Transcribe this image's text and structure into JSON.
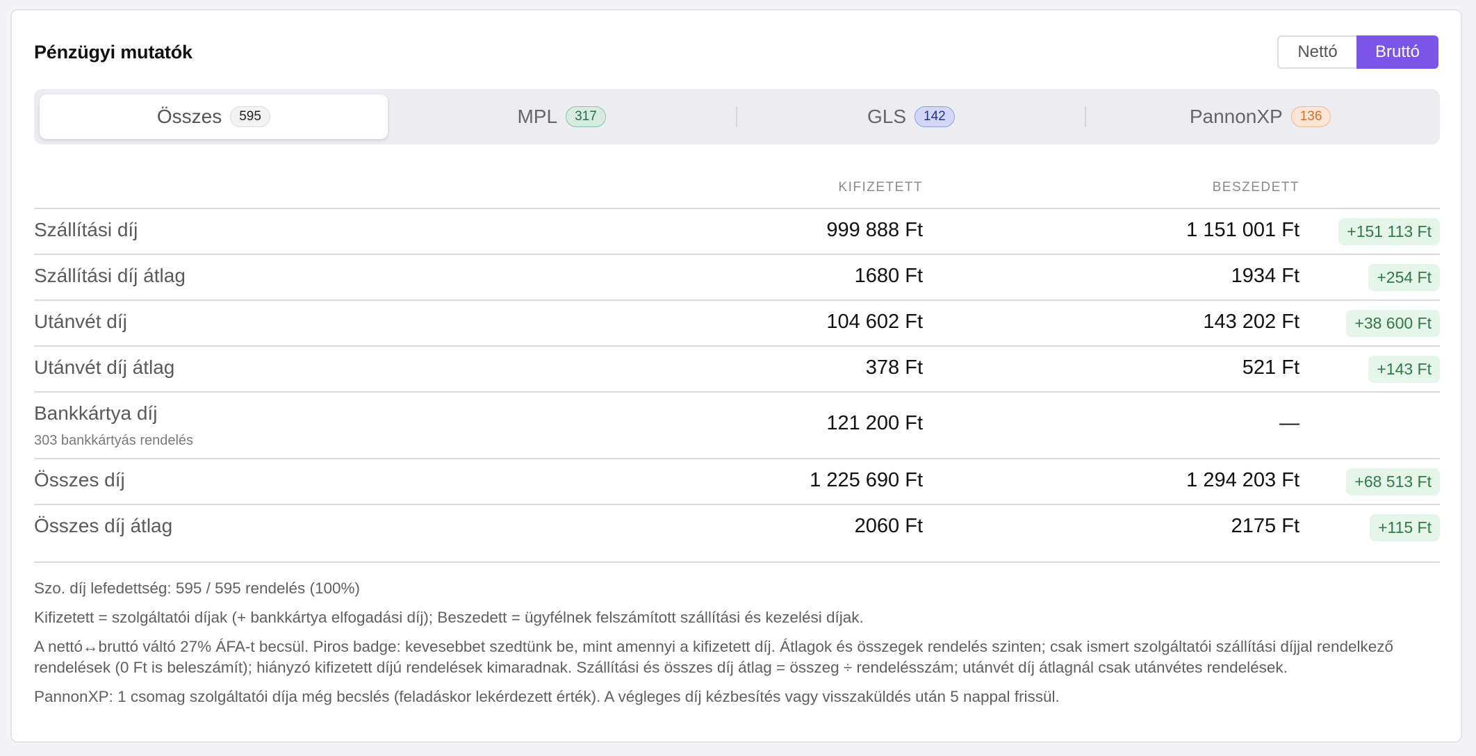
{
  "header": {
    "title": "Pénzügyi mutatók",
    "toggle": {
      "netto_label": "Nettó",
      "brutto_label": "Bruttó",
      "selected": "Bruttó"
    }
  },
  "colors": {
    "accent": "#7a55e8",
    "positive_badge_bg": "#e6f5ea",
    "positive_badge_text": "#2f7a44"
  },
  "tabs": [
    {
      "label": "Összes",
      "count": "595",
      "active": true
    },
    {
      "label": "MPL",
      "count": "317",
      "active": false
    },
    {
      "label": "GLS",
      "count": "142",
      "active": false
    },
    {
      "label": "PannonXP",
      "count": "136",
      "active": false
    }
  ],
  "table": {
    "columns": {
      "paid": "KIFIZETETT",
      "collected": "BESZEDETT"
    },
    "rows": [
      {
        "label": "Szállítási díj",
        "paid": "999 888 Ft",
        "collected": "1 151 001 Ft",
        "diff": "+151 113 Ft"
      },
      {
        "label": "Szállítási díj átlag",
        "paid": "1680 Ft",
        "collected": "1934 Ft",
        "diff": "+254 Ft"
      },
      {
        "label": "Utánvét díj",
        "paid": "104 602 Ft",
        "collected": "143 202 Ft",
        "diff": "+38 600 Ft"
      },
      {
        "label": "Utánvét díj átlag",
        "paid": "378 Ft",
        "collected": "521 Ft",
        "diff": "+143 Ft"
      },
      {
        "label": "Bankkártya díj",
        "sub": "303 bankkártyás rendelés",
        "paid": "121 200 Ft",
        "collected": "—",
        "diff": ""
      },
      {
        "label": "Összes díj",
        "paid": "1 225 690 Ft",
        "collected": "1 294 203 Ft",
        "diff": "+68 513 Ft"
      },
      {
        "label": "Összes díj átlag",
        "paid": "2060 Ft",
        "collected": "2175 Ft",
        "diff": "+115 Ft"
      }
    ]
  },
  "notes": [
    "Szo. díj lefedettség: 595 / 595 rendelés (100%)",
    "Kifizetett = szolgáltatói díjak (+ bankkártya elfogadási díj); Beszedett = ügyfélnek felszámított szállítási és kezelési díjak.",
    "A nettó↔bruttó váltó 27% ÁFA-t becsül. Piros badge: kevesebbet szedtünk be, mint amennyi a kifizetett díj. Átlagok és összegek rendelés szinten; csak ismert szolgáltatói szállítási díjjal rendelkező rendelések (0 Ft is beleszámít); hiányzó kifizetett díjú rendelések kimaradnak. Szállítási és összes díj átlag = összeg ÷ rendelésszám; utánvét díj átlagnál csak utánvétes rendelések.",
    "PannonXP: 1 csomag szolgáltatói díja még becslés (feladáskor lekérdezett érték). A végleges díj kézbesítés vagy visszaküldés után 5 nappal frissül."
  ]
}
